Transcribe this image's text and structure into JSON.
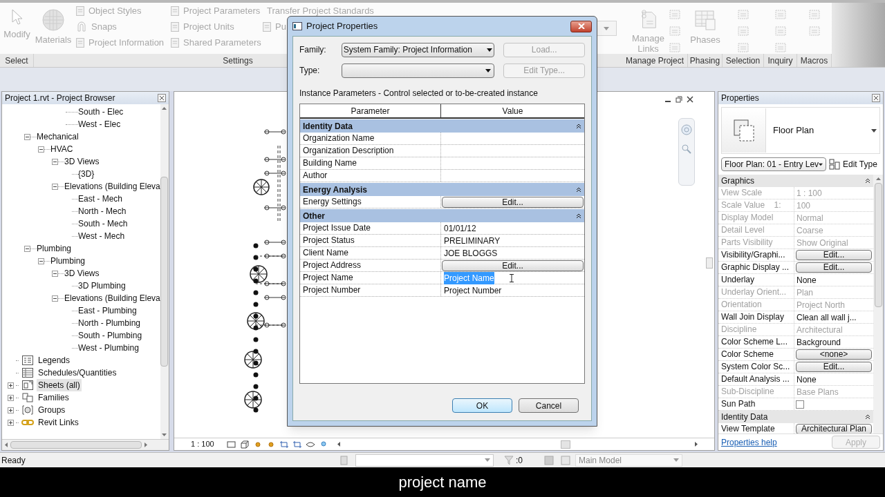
{
  "ribbon": {
    "groups": [
      {
        "label": "Select",
        "big_tools": [
          "Modify"
        ]
      },
      {
        "label": "Settings",
        "big_tools": [
          "Materials"
        ],
        "small_tools": [
          "Object Styles",
          "Snaps",
          "Project Information",
          "Project Parameters",
          "Project Units",
          "Shared Parameters",
          "Transfer Project Standards",
          "Pu"
        ]
      },
      {
        "label": "Manage Project",
        "big_tools": [
          "Manage Links"
        ]
      },
      {
        "label": "Phasing",
        "big_tools": [
          "Phases"
        ]
      },
      {
        "label": "Selection"
      },
      {
        "label": "Inquiry"
      },
      {
        "label": "Macros"
      }
    ]
  },
  "browser": {
    "title": "Project 1.rvt - Project Browser",
    "scrolled_leaves": [
      "South - Elec",
      "West - Elec"
    ],
    "scrolled_children": [
      {
        "label": "Mechanical",
        "expanded": true,
        "children": [
          {
            "label": "HVAC",
            "expanded": true,
            "children": [
              {
                "label": "3D Views",
                "expanded": true,
                "children": [
                  {
                    "label": "{3D}"
                  }
                ]
              },
              {
                "label": "Elevations (Building Eleva",
                "expanded": true,
                "children": [
                  {
                    "label": "East - Mech"
                  },
                  {
                    "label": "North - Mech"
                  },
                  {
                    "label": "South - Mech"
                  },
                  {
                    "label": "West - Mech"
                  }
                ]
              }
            ]
          }
        ]
      },
      {
        "label": "Plumbing",
        "expanded": true,
        "children": [
          {
            "label": "Plumbing",
            "expanded": true,
            "children": [
              {
                "label": "3D Views",
                "expanded": true,
                "children": [
                  {
                    "label": "3D Plumbing"
                  }
                ]
              },
              {
                "label": "Elevations (Building Eleva",
                "expanded": true,
                "children": [
                  {
                    "label": "East - Plumbing"
                  },
                  {
                    "label": "North - Plumbing"
                  },
                  {
                    "label": "South - Plumbing"
                  },
                  {
                    "label": "West - Plumbing"
                  }
                ]
              }
            ]
          }
        ]
      }
    ],
    "roots": [
      {
        "label": "Legends",
        "kind": "legends",
        "selected": false
      },
      {
        "label": "Schedules/Quantities",
        "kind": "schedules",
        "selected": false
      },
      {
        "label": "Sheets (all)",
        "kind": "sheets",
        "selected": true,
        "expanded": false
      },
      {
        "label": "Families",
        "kind": "families",
        "selected": false,
        "expanded": false
      },
      {
        "label": "Groups",
        "kind": "groups",
        "selected": false,
        "expanded": false
      },
      {
        "label": "Revit Links",
        "kind": "links",
        "selected": false,
        "expanded": false
      }
    ]
  },
  "view": {
    "scale": "1 : 100"
  },
  "dialog": {
    "title": "Project Properties",
    "family_label": "Family:",
    "family_value": "System Family: Project Information",
    "load_button": "Load...",
    "type_label": "Type:",
    "edit_type_button": "Edit Type...",
    "instance_caption": "Instance Parameters - Control selected or to-be-created instance",
    "columns": [
      "Parameter",
      "Value"
    ],
    "sections": [
      {
        "title": "Identity Data",
        "rows": [
          {
            "name": "Organization Name",
            "kind": "text",
            "value": ""
          },
          {
            "name": "Organization Description",
            "kind": "text",
            "value": ""
          },
          {
            "name": "Building Name",
            "kind": "text",
            "value": ""
          },
          {
            "name": "Author",
            "kind": "text",
            "value": ""
          }
        ]
      },
      {
        "title": "Energy Analysis",
        "rows": [
          {
            "name": "Energy Settings",
            "kind": "button",
            "value": "Edit..."
          }
        ]
      },
      {
        "title": "Other",
        "rows": [
          {
            "name": "Project Issue Date",
            "kind": "text",
            "value": "01/01/12",
            "selected": false
          },
          {
            "name": "Project Status",
            "kind": "text",
            "value": "PRELIMINARY",
            "selected": false
          },
          {
            "name": "Client Name",
            "kind": "text",
            "value": "JOE BLOGGS",
            "selected": false
          },
          {
            "name": "Project Address",
            "kind": "button",
            "value": "Edit..."
          },
          {
            "name": "Project Name",
            "kind": "text",
            "value": "Project Name",
            "selected": true
          },
          {
            "name": "Project Number",
            "kind": "text",
            "value": "Project Number",
            "selected": false
          }
        ]
      }
    ],
    "ok": "OK",
    "cancel": "Cancel"
  },
  "properties": {
    "title": "Properties",
    "type_name": "Floor Plan",
    "instance": "Floor Plan: 01 - Entry Lev",
    "edit_type": "Edit Type",
    "sections": [
      {
        "title": "Graphics",
        "rows": [
          {
            "name": "View Scale",
            "kind": "text",
            "value": "1 : 100",
            "disabled": true
          },
          {
            "name": "Scale Value    1:",
            "kind": "text",
            "value": "100",
            "disabled": true
          },
          {
            "name": "Display Model",
            "kind": "text",
            "value": "Normal",
            "disabled": true
          },
          {
            "name": "Detail Level",
            "kind": "text",
            "value": "Coarse",
            "disabled": true
          },
          {
            "name": "Parts Visibility",
            "kind": "text",
            "value": "Show Original",
            "disabled": true
          },
          {
            "name": "Visibility/Graphi...",
            "kind": "button",
            "value": "Edit...",
            "disabled": false
          },
          {
            "name": "Graphic Display ...",
            "kind": "button",
            "value": "Edit...",
            "disabled": false
          },
          {
            "name": "Underlay",
            "kind": "text",
            "value": "None",
            "disabled": false
          },
          {
            "name": "Underlay Orient...",
            "kind": "text",
            "value": "Plan",
            "disabled": true
          },
          {
            "name": "Orientation",
            "kind": "text",
            "value": "Project North",
            "disabled": true
          },
          {
            "name": "Wall Join Display",
            "kind": "text",
            "value": "Clean all wall j...",
            "disabled": false
          },
          {
            "name": "Discipline",
            "kind": "text",
            "value": "Architectural",
            "disabled": true
          },
          {
            "name": "Color Scheme L...",
            "kind": "text",
            "value": "Background",
            "disabled": false
          },
          {
            "name": "Color Scheme",
            "kind": "button",
            "value": "<none>",
            "disabled": false
          },
          {
            "name": "System Color Sc...",
            "kind": "button",
            "value": "Edit...",
            "disabled": false
          },
          {
            "name": "Default Analysis ...",
            "kind": "text",
            "value": "None",
            "disabled": false
          },
          {
            "name": "Sub-Discipline",
            "kind": "text",
            "value": "Base Plans",
            "disabled": true
          },
          {
            "name": "Sun Path",
            "kind": "checkbox",
            "checked": false,
            "disabled": false
          }
        ]
      },
      {
        "title": "Identity Data",
        "rows": [
          {
            "name": "View Template",
            "kind": "button",
            "value": "Architectural Plan",
            "disabled": false
          }
        ]
      }
    ],
    "help": "Properties help",
    "apply": "Apply"
  },
  "status_bar": {
    "text": "Ready",
    "count": ":0",
    "model": "Main Model"
  },
  "caption": "project name"
}
